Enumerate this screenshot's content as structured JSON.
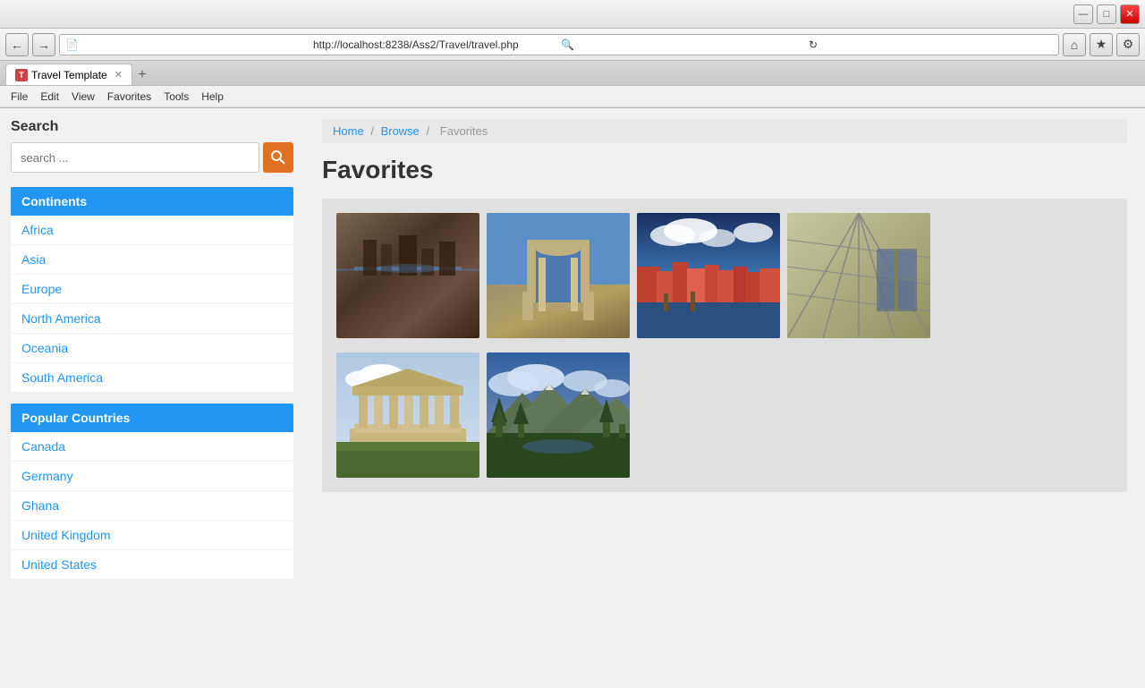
{
  "browser": {
    "url": "http://localhost:8238/Ass2/Travel/travel.php",
    "tab_title": "Travel Template",
    "tab_icon": "T"
  },
  "menu": {
    "items": [
      "File",
      "Edit",
      "View",
      "Favorites",
      "Tools",
      "Help"
    ]
  },
  "sidebar": {
    "search_title": "Search",
    "search_placeholder": "search ...",
    "continents_header": "Continents",
    "continents": [
      {
        "label": "Africa"
      },
      {
        "label": "Asia"
      },
      {
        "label": "Europe"
      },
      {
        "label": "North America"
      },
      {
        "label": "Oceania"
      },
      {
        "label": "South America"
      }
    ],
    "countries_header": "Popular Countries",
    "countries": [
      {
        "label": "Canada"
      },
      {
        "label": "Germany"
      },
      {
        "label": "Ghana"
      },
      {
        "label": "United Kingdom"
      },
      {
        "label": "United States"
      }
    ]
  },
  "breadcrumb": {
    "home": "Home",
    "browse": "Browse",
    "current": "Favorites",
    "sep1": "/",
    "sep2": "/"
  },
  "main": {
    "title": "Favorites"
  }
}
